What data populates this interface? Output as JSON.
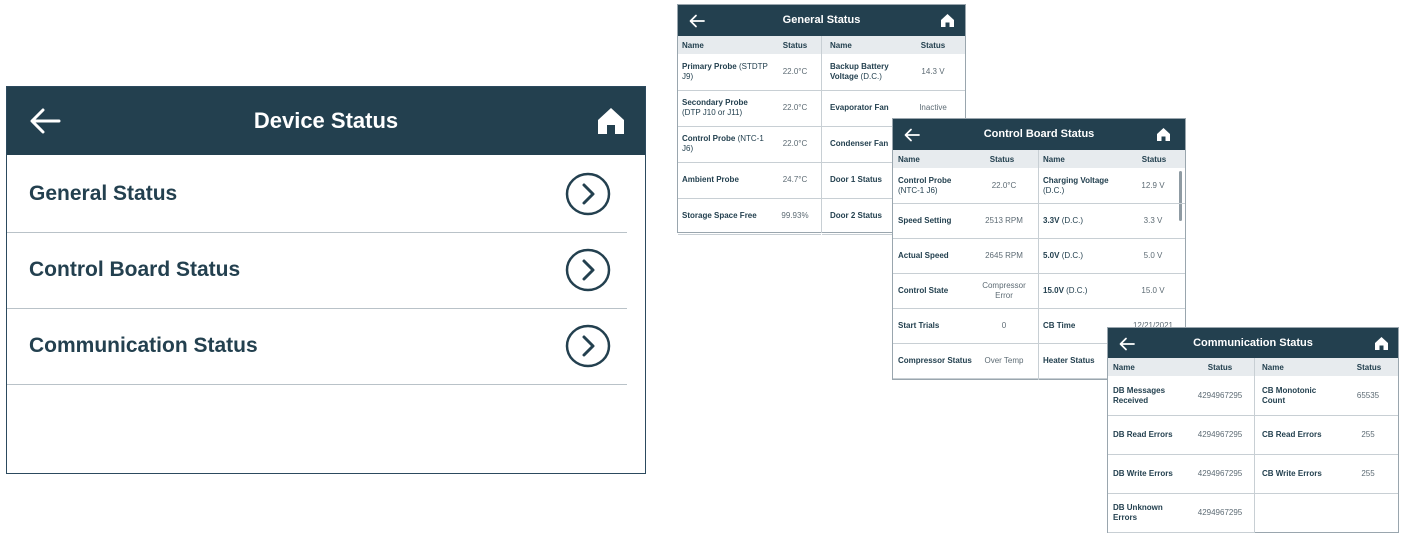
{
  "device_status": {
    "title": "Device Status",
    "items": [
      {
        "label": "General Status"
      },
      {
        "label": "Control Board Status"
      },
      {
        "label": "Communication Status"
      }
    ]
  },
  "general_status": {
    "title": "General Status",
    "headers": {
      "name": "Name",
      "status": "Status"
    },
    "left": [
      {
        "name": "Primary Probe",
        "sub": "(STDTP J9)",
        "value": "22.0°C"
      },
      {
        "name": "Secondary Probe",
        "sub": "(DTP J10 or J11)",
        "value": "22.0°C"
      },
      {
        "name": "Control Probe",
        "sub": "(NTC-1 J6)",
        "value": "22.0°C"
      },
      {
        "name": "Ambient Probe",
        "sub": "",
        "value": "24.7°C"
      },
      {
        "name": "Storage Space Free",
        "sub": "",
        "value": "99.93%"
      }
    ],
    "right": [
      {
        "name": "Backup Battery Voltage",
        "sub": "(D.C.)",
        "value": "14.3 V"
      },
      {
        "name": "Evaporator Fan",
        "sub": "",
        "value": "Inactive"
      },
      {
        "name": "Condenser Fan",
        "sub": "",
        "value": ""
      },
      {
        "name": "Door 1 Status",
        "sub": "",
        "value": ""
      },
      {
        "name": "Door 2 Status",
        "sub": "",
        "value": ""
      }
    ]
  },
  "control_board_status": {
    "title": "Control Board Status",
    "headers": {
      "name": "Name",
      "status": "Status"
    },
    "left": [
      {
        "name": "Control Probe",
        "sub": "(NTC-1 J6)",
        "value": "22.0°C"
      },
      {
        "name": "Speed Setting",
        "sub": "",
        "value": "2513 RPM"
      },
      {
        "name": "Actual Speed",
        "sub": "",
        "value": "2645 RPM"
      },
      {
        "name": "Control State",
        "sub": "",
        "value": "Compressor Error"
      },
      {
        "name": "Start Trials",
        "sub": "",
        "value": "0"
      },
      {
        "name": "Compressor Status",
        "sub": "",
        "value": "Over Temp"
      }
    ],
    "right": [
      {
        "name": "Charging Voltage",
        "sub": "(D.C.)",
        "value": "12.9 V"
      },
      {
        "name": "3.3V",
        "sub": "(D.C.)",
        "value": "3.3 V"
      },
      {
        "name": "5.0V",
        "sub": "(D.C.)",
        "value": "5.0 V"
      },
      {
        "name": "15.0V",
        "sub": "(D.C.)",
        "value": "15.0 V"
      },
      {
        "name": "CB Time",
        "sub": "",
        "value": "12/21/2021"
      },
      {
        "name": "Heater Status",
        "sub": "",
        "value": ""
      }
    ]
  },
  "communication_status": {
    "title": "Communication Status",
    "headers": {
      "name": "Name",
      "status": "Status"
    },
    "left": [
      {
        "name": "DB Messages Received",
        "value": "4294967295"
      },
      {
        "name": "DB Read Errors",
        "value": "4294967295"
      },
      {
        "name": "DB Write Errors",
        "value": "4294967295"
      },
      {
        "name": "DB Unknown Errors",
        "value": "4294967295"
      }
    ],
    "right": [
      {
        "name": "CB Monotonic Count",
        "value": "65535"
      },
      {
        "name": "CB Read Errors",
        "value": "255"
      },
      {
        "name": "CB Write Errors",
        "value": "255"
      }
    ]
  },
  "icons": {
    "back": "arrow-left-icon",
    "home": "home-icon",
    "chevron": "chevron-right-circle-icon"
  },
  "colors": {
    "header": "#23404f",
    "accent_text": "#23404f",
    "divider": "#b9c2c8"
  }
}
